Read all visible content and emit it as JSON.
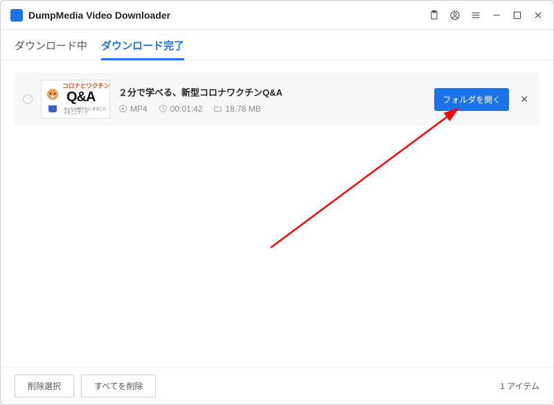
{
  "header": {
    "title": "DumpMedia Video Downloader"
  },
  "tabs": {
    "downloading": "ダウンロード中",
    "completed": "ダウンロード完了"
  },
  "item": {
    "thumb_title": "コロナとワクチン",
    "thumb_qa": "Q&A",
    "thumb_sub": "みんなが知りたい\nそのこたえをここでーク",
    "title": "２分で学べる、新型コロナワクチンQ&A",
    "format": "MP4",
    "duration": "00:01:42",
    "size": "18.78 MB",
    "open_folder": "フォルダを開く"
  },
  "footer": {
    "delete_selected": "削除選択",
    "delete_all": "すべてを削除",
    "count": "1 アイテム"
  }
}
